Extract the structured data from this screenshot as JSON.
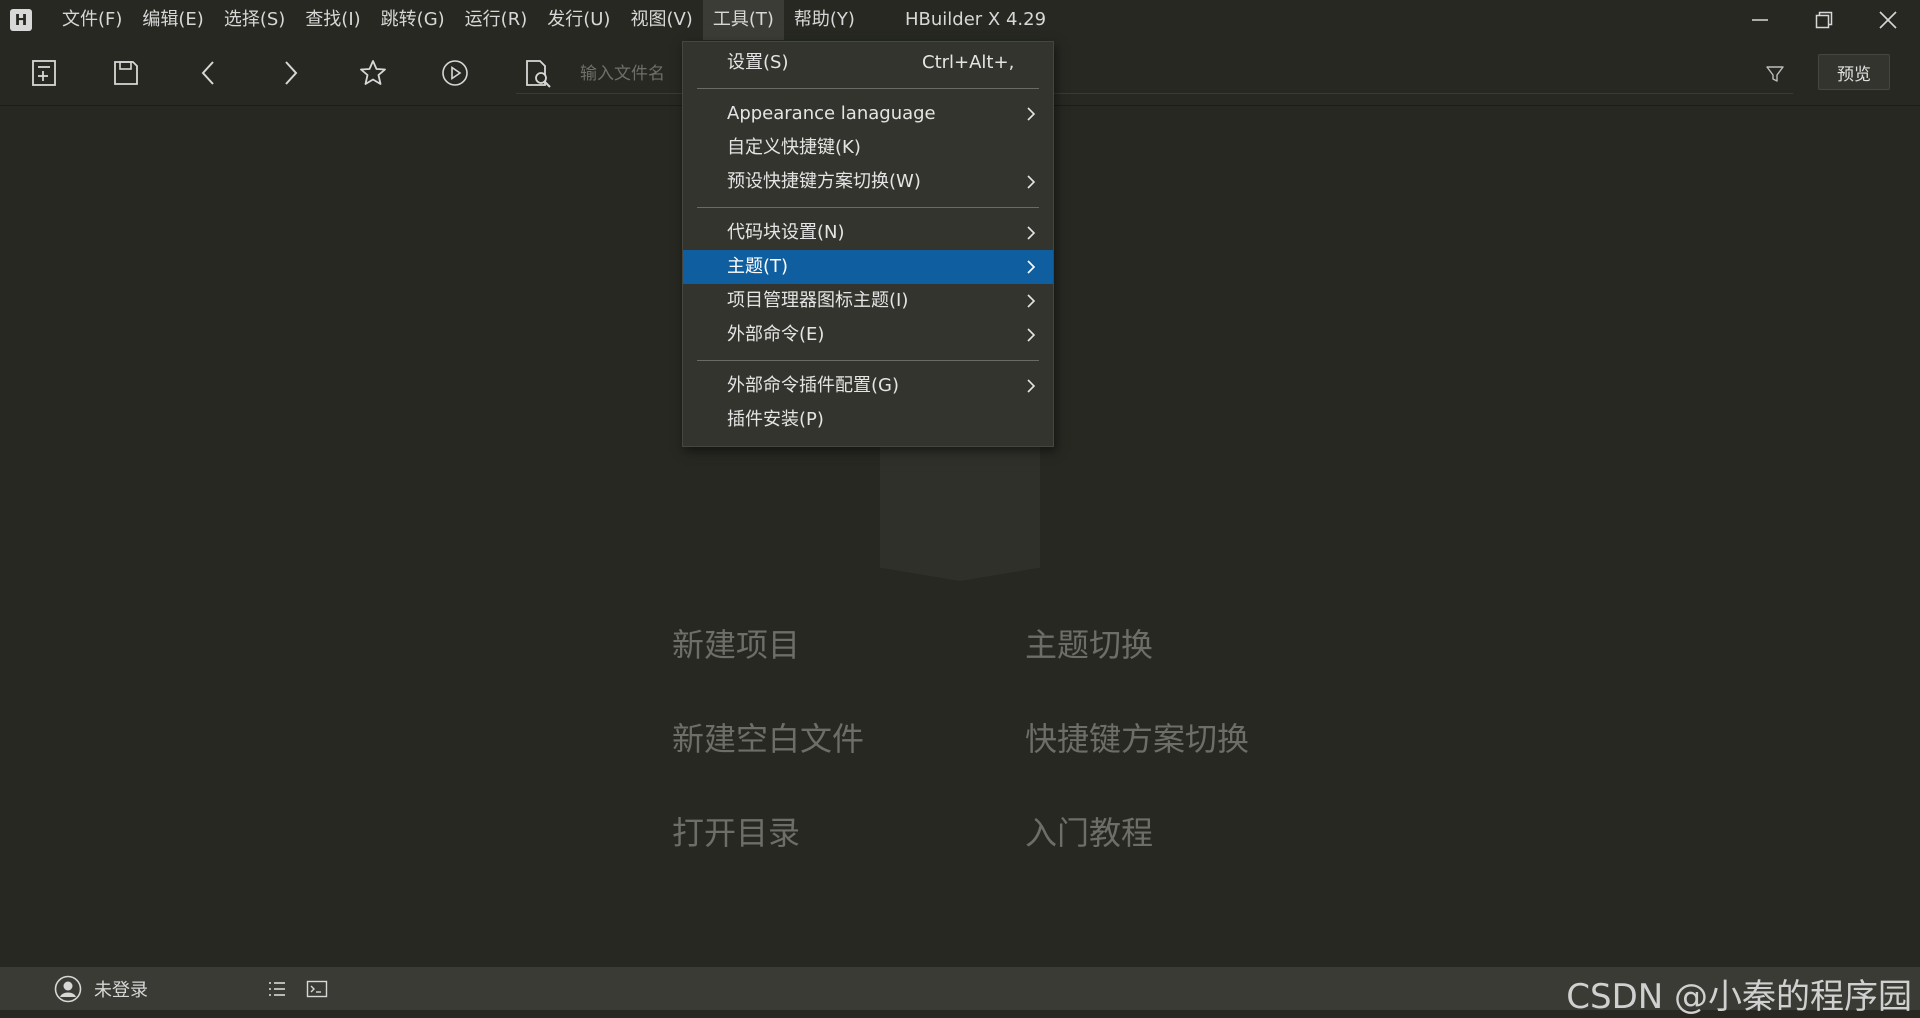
{
  "window": {
    "title": "HBuilder X 4.29"
  },
  "menubar": {
    "items": [
      {
        "label": "文件(F)"
      },
      {
        "label": "编辑(E)"
      },
      {
        "label": "选择(S)"
      },
      {
        "label": "查找(I)"
      },
      {
        "label": "跳转(G)"
      },
      {
        "label": "运行(R)"
      },
      {
        "label": "发行(U)"
      },
      {
        "label": "视图(V)"
      },
      {
        "label": "工具(T)"
      },
      {
        "label": "帮助(Y)"
      }
    ]
  },
  "toolbar": {
    "search_placeholder": "输入文件名",
    "preview_label": "预览",
    "icons": [
      "new-file-icon",
      "save-icon",
      "back-icon",
      "forward-icon",
      "star-icon",
      "run-icon",
      "find-file-icon",
      "filter-icon"
    ]
  },
  "dropdown": {
    "settings": {
      "label": "设置(S)",
      "shortcut": "Ctrl+Alt+,"
    },
    "appearance": {
      "label": "Appearance lanaguage"
    },
    "custom_keys": {
      "label": "自定义快捷键(K)"
    },
    "preset_keys": {
      "label": "预设快捷键方案切换(W)"
    },
    "snippets": {
      "label": "代码块设置(N)"
    },
    "theme": {
      "label": "主题(T)"
    },
    "icon_theme": {
      "label": "项目管理器图标主题(I)"
    },
    "external_cmd": {
      "label": "外部命令(E)"
    },
    "external_plugin": {
      "label": "外部命令插件配置(G)"
    },
    "plugin_install": {
      "label": "插件安装(P)"
    },
    "highlight_color": "#0f5fa0"
  },
  "main": {
    "links": {
      "new_project": "新建项目",
      "theme_switch": "主题切换",
      "new_blank_file": "新建空白文件",
      "keymap_switch": "快捷键方案切换",
      "open_dir": "打开目录",
      "tutorial": "入门教程"
    }
  },
  "statusbar": {
    "user_label": "未登录",
    "watermark": "CSDN @小秦的程序园"
  },
  "colors": {
    "background": "#272822",
    "statusbar": "#3a3b35",
    "menu_bg": "#33342e"
  }
}
